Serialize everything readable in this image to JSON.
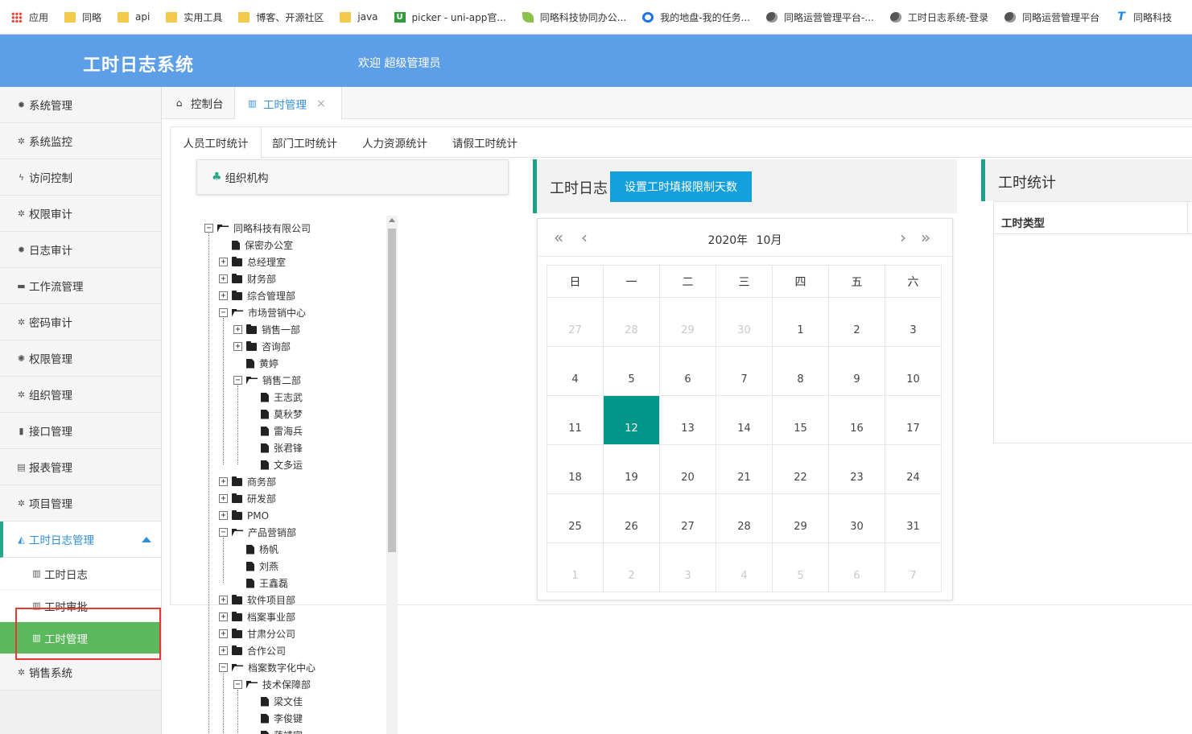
{
  "bookmarks": [
    {
      "label": "应用",
      "icon": "apps-grid-icon"
    },
    {
      "label": "同略",
      "icon": "folder-icon"
    },
    {
      "label": "api",
      "icon": "folder-icon"
    },
    {
      "label": "实用工具",
      "icon": "folder-icon"
    },
    {
      "label": "博客、开源社区",
      "icon": "folder-icon"
    },
    {
      "label": "java",
      "icon": "folder-icon"
    },
    {
      "label": "picker - uni-app官...",
      "icon": "uniapp-icon"
    },
    {
      "label": "同略科技协同办公...",
      "icon": "leaf-icon"
    },
    {
      "label": "我的地盘-我的任务...",
      "icon": "disk-icon"
    },
    {
      "label": "同略运营管理平台-...",
      "icon": "globe-icon"
    },
    {
      "label": "工时日志系统-登录",
      "icon": "globe-icon"
    },
    {
      "label": "同略运营管理平台",
      "icon": "globe-icon"
    },
    {
      "label": "同略科技",
      "icon": "t-logo-icon"
    }
  ],
  "header": {
    "title": "工时日志系统",
    "welcome": "欢迎 超级管理员"
  },
  "sidebar": {
    "items": [
      {
        "label": "系统管理",
        "icon": "gear-icon"
      },
      {
        "label": "系统监控",
        "icon": "gears-icon"
      },
      {
        "label": "访问控制",
        "icon": "bolt-icon"
      },
      {
        "label": "权限审计",
        "icon": "gears-icon"
      },
      {
        "label": "日志审计",
        "icon": "gear-icon"
      },
      {
        "label": "工作流管理",
        "icon": "calendar-icon"
      },
      {
        "label": "密码审计",
        "icon": "gears-icon"
      },
      {
        "label": "权限管理",
        "icon": "cog-icon"
      },
      {
        "label": "组织管理",
        "icon": "gears-icon"
      },
      {
        "label": "接口管理",
        "icon": "book-icon"
      },
      {
        "label": "报表管理",
        "icon": "newspaper-icon"
      },
      {
        "label": "项目管理",
        "icon": "gears-icon"
      }
    ],
    "active": {
      "label": "工时日志管理",
      "icon": "area-chart-icon"
    },
    "sub_items": [
      {
        "label": "工时日志",
        "icon": "bar-chart-icon"
      },
      {
        "label": "工时审批",
        "icon": "bar-chart-icon"
      },
      {
        "label": "工时管理",
        "icon": "bar-chart-icon"
      }
    ],
    "after": {
      "label": "销售系统",
      "icon": "gears-icon"
    }
  },
  "tabs": {
    "console": "控制台",
    "manage": "工时管理",
    "close": "×"
  },
  "subtabs": [
    "人员工时统计",
    "部门工时统计",
    "人力资源统计",
    "请假工时统计"
  ],
  "org": {
    "title": "组织机构"
  },
  "tree": [
    {
      "label": "同略科技有限公司",
      "type": "open",
      "toggle": "minus"
    },
    {
      "label": "保密办公室",
      "type": "file",
      "toggle": "none"
    },
    {
      "label": "总经理室",
      "type": "folder",
      "toggle": "plus"
    },
    {
      "label": "财务部",
      "type": "folder",
      "toggle": "plus"
    },
    {
      "label": "综合管理部",
      "type": "folder",
      "toggle": "plus"
    },
    {
      "label": "市场营销中心",
      "type": "open",
      "toggle": "minus"
    },
    {
      "label": "销售一部",
      "type": "folder",
      "toggle": "plus"
    },
    {
      "label": "咨询部",
      "type": "folder",
      "toggle": "plus"
    },
    {
      "label": "黄婷",
      "type": "file",
      "toggle": "none"
    },
    {
      "label": "销售二部",
      "type": "open",
      "toggle": "minus"
    },
    {
      "label": "王志武",
      "type": "file",
      "toggle": "none"
    },
    {
      "label": "莫秋梦",
      "type": "file",
      "toggle": "none"
    },
    {
      "label": "雷海兵",
      "type": "file",
      "toggle": "none"
    },
    {
      "label": "张君锋",
      "type": "file",
      "toggle": "none"
    },
    {
      "label": "文多运",
      "type": "file",
      "toggle": "none"
    },
    {
      "label": "商务部",
      "type": "folder",
      "toggle": "plus"
    },
    {
      "label": "研发部",
      "type": "folder",
      "toggle": "plus"
    },
    {
      "label": "PMO",
      "type": "folder",
      "toggle": "plus"
    },
    {
      "label": "产品营销部",
      "type": "open",
      "toggle": "minus"
    },
    {
      "label": "杨帆",
      "type": "file",
      "toggle": "none"
    },
    {
      "label": "刘燕",
      "type": "file",
      "toggle": "none"
    },
    {
      "label": "王鑫磊",
      "type": "file",
      "toggle": "none"
    },
    {
      "label": "软件项目部",
      "type": "folder",
      "toggle": "plus"
    },
    {
      "label": "档案事业部",
      "type": "folder",
      "toggle": "plus"
    },
    {
      "label": "甘肃分公司",
      "type": "folder",
      "toggle": "plus"
    },
    {
      "label": "合作公司",
      "type": "folder",
      "toggle": "plus"
    },
    {
      "label": "档案数字化中心",
      "type": "open",
      "toggle": "minus"
    },
    {
      "label": "技术保障部",
      "type": "open",
      "toggle": "minus"
    },
    {
      "label": "梁文佳",
      "type": "file",
      "toggle": "none"
    },
    {
      "label": "李俊键",
      "type": "file",
      "toggle": "none"
    },
    {
      "label": "蒋靖宇",
      "type": "file",
      "toggle": "none"
    }
  ],
  "log": {
    "title": "工时日志",
    "button": "设置工时填报限制天数"
  },
  "calendar": {
    "year": "2020年",
    "month": "10月",
    "nav": {
      "prev_year": "«",
      "prev_month": "‹",
      "next_month": "›",
      "next_year": "»"
    },
    "weekdays": [
      "日",
      "一",
      "二",
      "三",
      "四",
      "五",
      "六"
    ],
    "weeks": [
      [
        "27",
        "28",
        "29",
        "30",
        "1",
        "2",
        "3"
      ],
      [
        "4",
        "5",
        "6",
        "7",
        "8",
        "9",
        "10"
      ],
      [
        "11",
        "12",
        "13",
        "14",
        "15",
        "16",
        "17"
      ],
      [
        "18",
        "19",
        "20",
        "21",
        "22",
        "23",
        "24"
      ],
      [
        "25",
        "26",
        "27",
        "28",
        "29",
        "30",
        "31"
      ],
      [
        "1",
        "2",
        "3",
        "4",
        "5",
        "6",
        "7"
      ]
    ],
    "selected": "12"
  },
  "stats": {
    "title": "工时统计",
    "column": "工时类型"
  },
  "colors": {
    "header": "#5d9fe6",
    "accent": "#009688",
    "button": "#14a0dc",
    "active_sub": "#5cb85c",
    "highlight": "#e53935"
  }
}
